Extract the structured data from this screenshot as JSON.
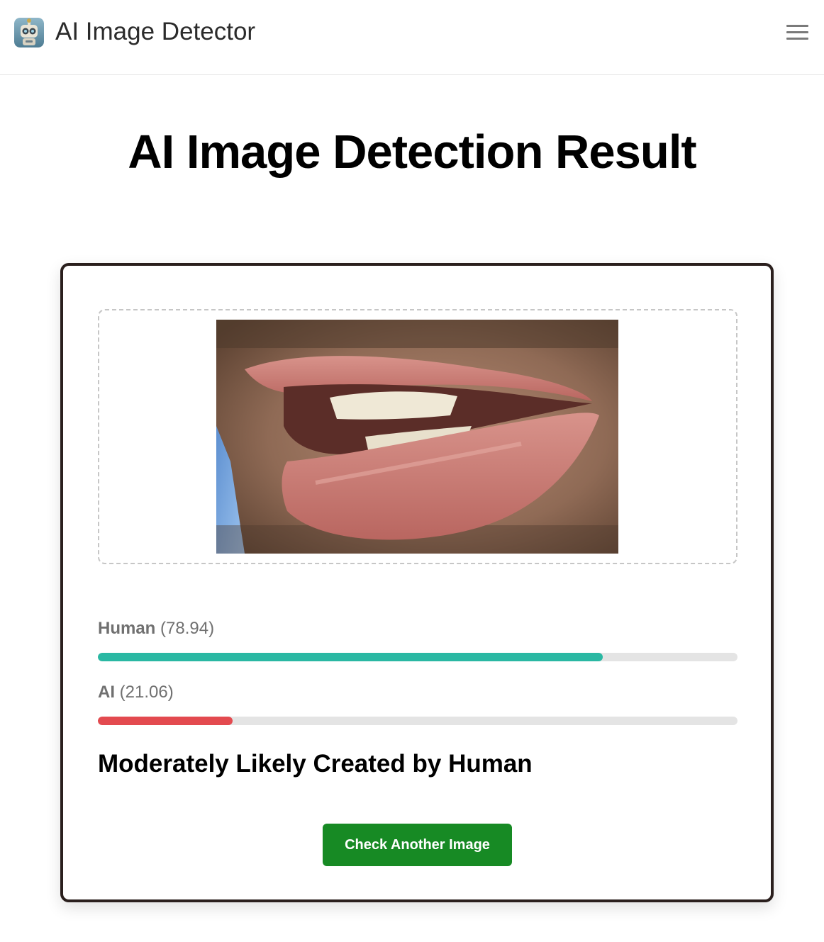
{
  "header": {
    "site_title": "AI Image Detector",
    "logo_icon": "robot-icon",
    "menu_icon": "hamburger-menu-icon"
  },
  "page": {
    "title": "AI Image Detection Result"
  },
  "result": {
    "uploaded_image": "uploaded-photo-mouth-closeup",
    "scores": [
      {
        "label": "Human",
        "value_text": "(78.94)",
        "percent": 78.94,
        "color": "#2ab8a3"
      },
      {
        "label": "AI",
        "value_text": "(21.06)",
        "percent": 21.06,
        "color": "#e34a4f"
      }
    ],
    "verdict": "Moderately Likely Created by Human",
    "button_label": "Check Another Image",
    "button_color": "#178a24"
  }
}
